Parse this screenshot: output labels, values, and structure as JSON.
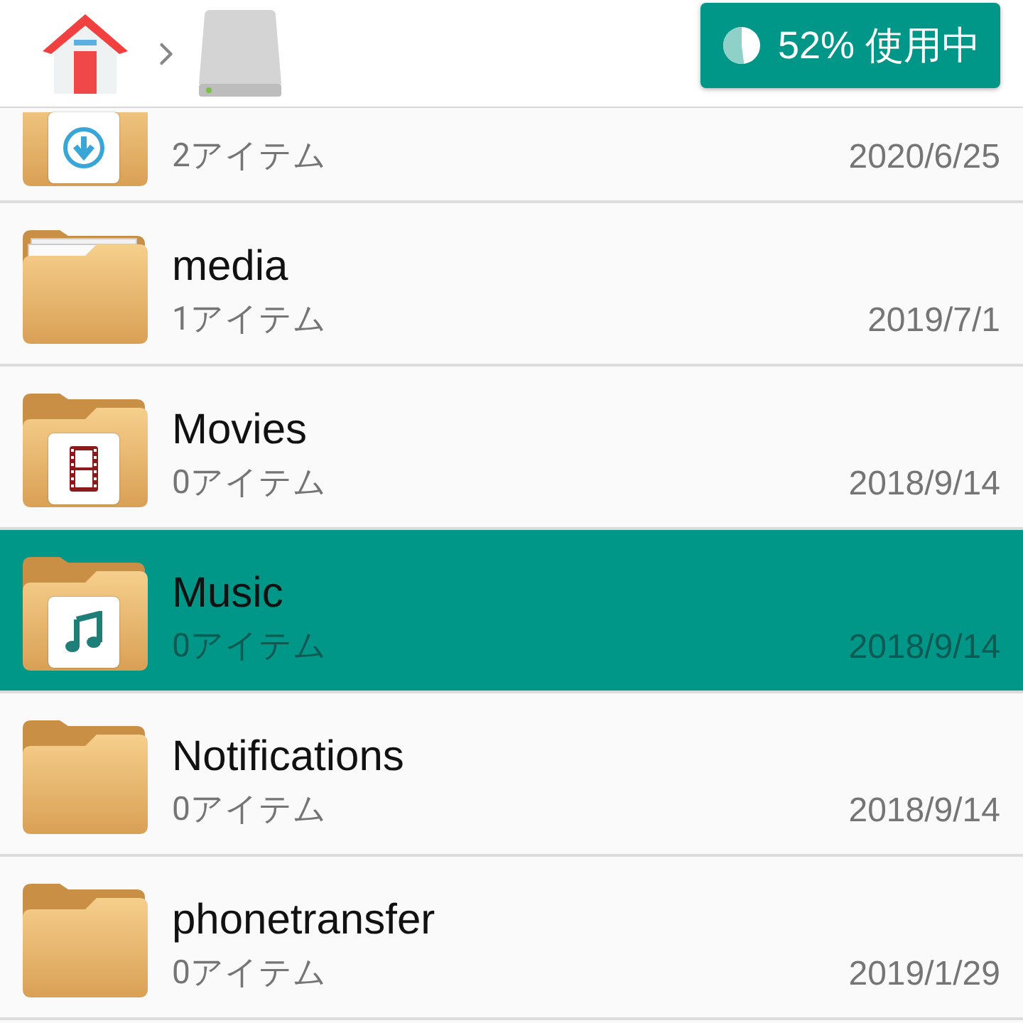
{
  "usage": {
    "label": "52% 使用中",
    "level": 0.52
  },
  "items": [
    {
      "kind": "download",
      "count": "2アイテム",
      "date": "2020/6/25",
      "selected": false
    },
    {
      "kind": "papers",
      "name": "media",
      "count": "1アイテム",
      "date": "2019/7/1",
      "selected": false
    },
    {
      "kind": "film",
      "name": "Movies",
      "count": "0アイテム",
      "date": "2018/9/14",
      "selected": false
    },
    {
      "kind": "music",
      "name": "Music",
      "count": "0アイテム",
      "date": "2018/9/14",
      "selected": true
    },
    {
      "kind": "plain",
      "name": "Notifications",
      "count": "0アイテム",
      "date": "2018/9/14",
      "selected": false
    },
    {
      "kind": "plain",
      "name": "phonetransfer",
      "count": "0アイテム",
      "date": "2019/1/29",
      "selected": false
    }
  ]
}
